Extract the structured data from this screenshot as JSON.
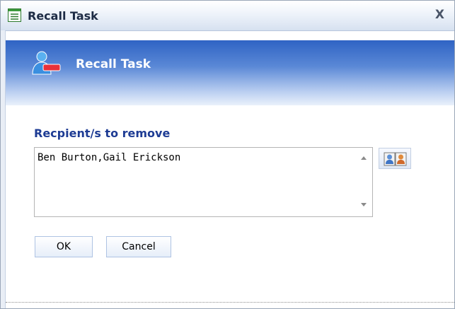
{
  "window": {
    "title": "Recall Task",
    "close_label": "X"
  },
  "header": {
    "title": "Recall Task"
  },
  "form": {
    "recipients_label": "Recpient/s to remove",
    "recipients_value": "Ben Burton,Gail Erickson"
  },
  "buttons": {
    "ok_label": "OK",
    "cancel_label": "Cancel"
  },
  "icons": {
    "window": "form-window-icon",
    "header": "user-remove-icon",
    "picker": "address-book-icon"
  }
}
